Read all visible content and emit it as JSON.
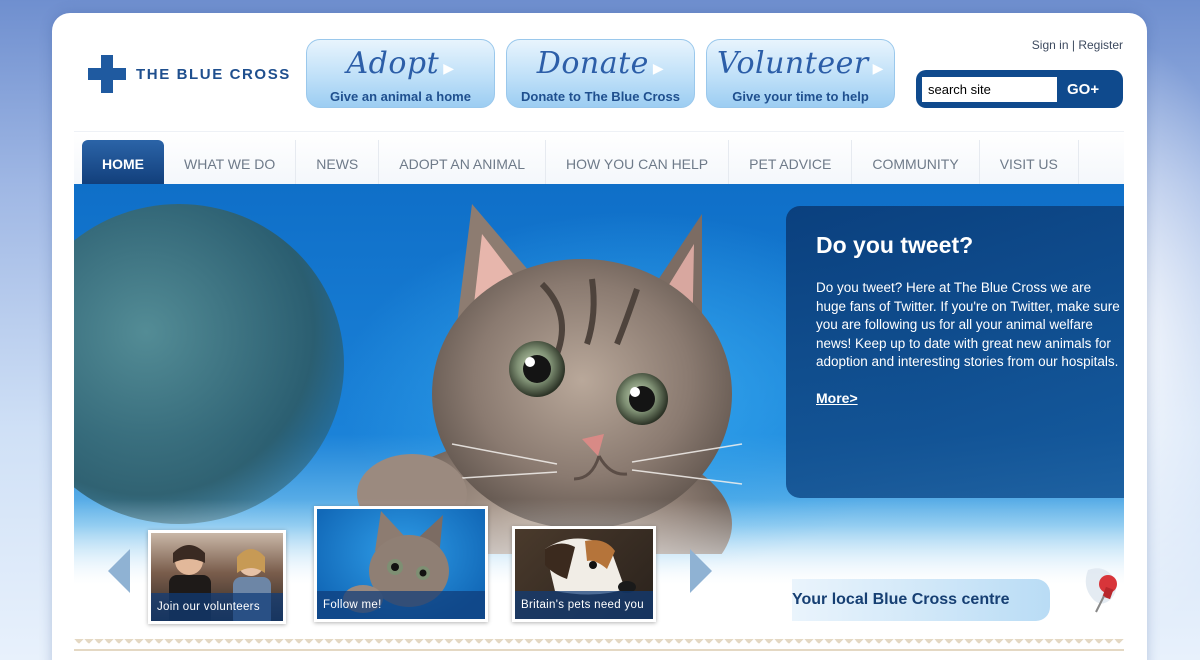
{
  "brand": {
    "name": "THE BLUE CROSS",
    "color": "#1f5aa0"
  },
  "actions": [
    {
      "title": "Adopt",
      "subtitle": "Give an animal a home"
    },
    {
      "title": "Donate",
      "subtitle": "Donate to The Blue Cross"
    },
    {
      "title": "Volunteer",
      "subtitle": "Give your time to help"
    }
  ],
  "account": {
    "signin": "Sign in",
    "separator": "|",
    "register": "Register"
  },
  "search": {
    "value": "search site",
    "button": "GO+"
  },
  "nav": {
    "items": [
      {
        "label": "HOME",
        "active": true
      },
      {
        "label": "WHAT WE DO"
      },
      {
        "label": "NEWS"
      },
      {
        "label": "ADOPT AN ANIMAL"
      },
      {
        "label": "HOW YOU CAN HELP"
      },
      {
        "label": "PET ADVICE"
      },
      {
        "label": "COMMUNITY"
      },
      {
        "label": "VISIT US"
      }
    ]
  },
  "feature": {
    "title": "Do you tweet?",
    "body": "Do you tweet? Here at The Blue Cross we are huge fans of Twitter. If you're on Twitter, make sure you are following us for all your animal welfare news! Keep up to date with great new animals for adoption and interesting stories from our hospitals.",
    "link": "More>"
  },
  "carousel": {
    "thumbs": [
      {
        "caption": "Join our volunteers"
      },
      {
        "caption": "Follow me!"
      },
      {
        "caption": "Britain's pets need you"
      }
    ]
  },
  "local": {
    "label": "Your local Blue Cross centre"
  },
  "colors": {
    "navy": "#123f7b",
    "accent": "#1f5aa0",
    "pin": "#d8353a"
  }
}
